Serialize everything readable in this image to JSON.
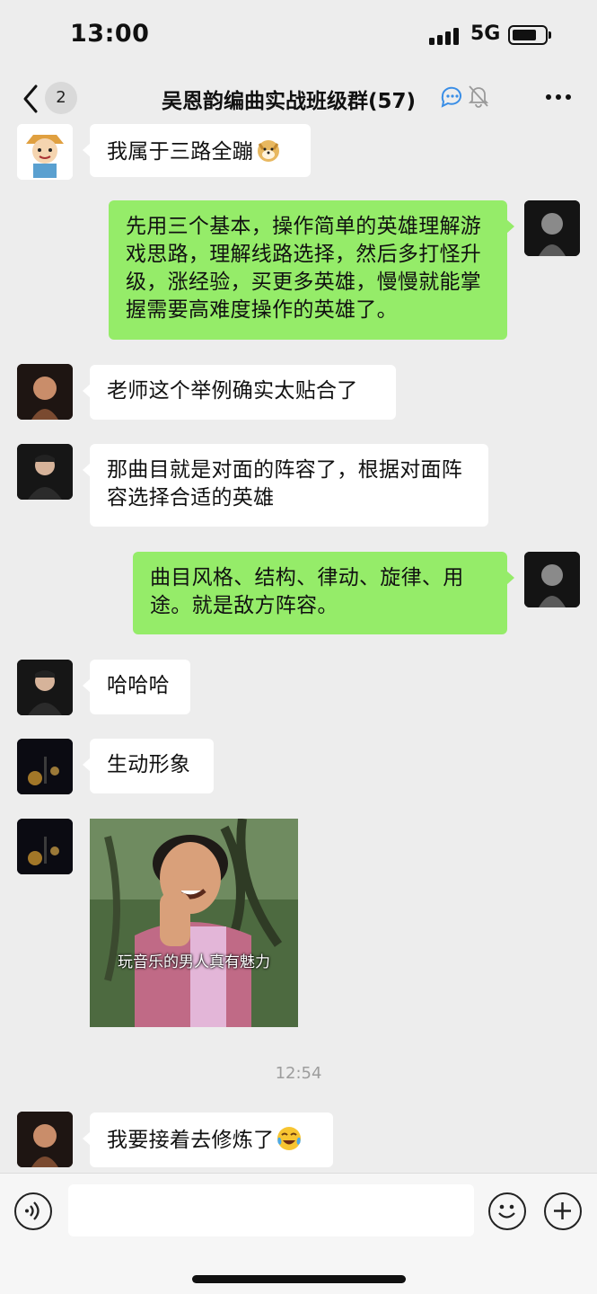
{
  "status_bar": {
    "time": "13:00",
    "network": "5G"
  },
  "header": {
    "back_count": "2",
    "title": "吴恩韵编曲实战班级群(57)"
  },
  "messages": [
    {
      "direction": "in",
      "text": "我属于三路全蹦",
      "emoji": "doge-emoji"
    },
    {
      "direction": "out",
      "text": "先用三个基本，操作简单的英雄理解游戏思路，理解线路选择，然后多打怪升级，涨经验，买更多英雄，慢慢就能掌握需要高难度操作的英雄了。"
    },
    {
      "direction": "in",
      "text": "老师这个举例确实太贴合了"
    },
    {
      "direction": "in",
      "text": "那曲目就是对面的阵容了，根据对面阵容选择合适的英雄"
    },
    {
      "direction": "out",
      "text": "曲目风格、结构、律动、旋律、用途。就是敌方阵容。"
    },
    {
      "direction": "in",
      "text": "哈哈哈"
    },
    {
      "direction": "in",
      "text": "生动形象"
    },
    {
      "direction": "in",
      "image_caption": "玩音乐的男人真有魅力"
    },
    {
      "direction": "in",
      "text": "我要接着去修炼了",
      "emoji": "laughing-tears-emoji"
    }
  ],
  "timestamp": "12:54",
  "colors": {
    "background": "#ededed",
    "bubble_in": "#ffffff",
    "bubble_out": "#95ec69",
    "timestamp": "#9d9d9d"
  }
}
